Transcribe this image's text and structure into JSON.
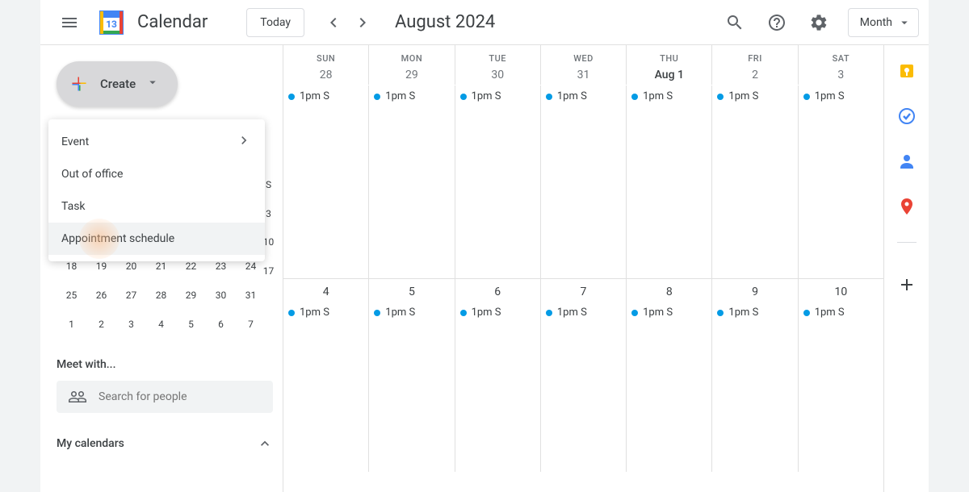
{
  "header": {
    "app_title": "Calendar",
    "today_label": "Today",
    "month_title": "August 2024",
    "view_label": "Month",
    "logo_date": "13"
  },
  "sidebar": {
    "create_label": "Create",
    "dropdown": {
      "items": [
        {
          "label": "Event",
          "has_submenu": true
        },
        {
          "label": "Out of office",
          "has_submenu": false
        },
        {
          "label": "Task",
          "has_submenu": false
        },
        {
          "label": "Appointment schedule",
          "has_submenu": false
        }
      ]
    },
    "mini_cal": {
      "visible_rows": [
        [
          "S",
          "",
          "",
          "",
          "",
          "",
          ""
        ],
        [
          "3",
          "",
          "",
          "",
          "",
          "",
          ""
        ],
        [
          "10",
          "",
          "",
          "",
          "",
          "",
          ""
        ],
        [
          "17",
          "",
          "",
          "",
          "",
          "",
          ""
        ],
        [
          "18",
          "19",
          "20",
          "21",
          "22",
          "23",
          "24"
        ],
        [
          "25",
          "26",
          "27",
          "28",
          "29",
          "30",
          "31"
        ],
        [
          "1",
          "2",
          "3",
          "4",
          "5",
          "6",
          "7"
        ]
      ]
    },
    "meet_title": "Meet with...",
    "search_placeholder": "Search for people",
    "my_calendars_label": "My calendars"
  },
  "calendar": {
    "days_of_week": [
      "SUN",
      "MON",
      "TUE",
      "WED",
      "THU",
      "FRI",
      "SAT"
    ],
    "week1": {
      "dates": [
        "28",
        "29",
        "30",
        "31",
        "Aug 1",
        "2",
        "3"
      ],
      "current_index": 4,
      "events": [
        "1pm S",
        "1pm S",
        "1pm S",
        "1pm S",
        "1pm S",
        "1pm S",
        "1pm S"
      ]
    },
    "week2": {
      "dates": [
        "4",
        "5",
        "6",
        "7",
        "8",
        "9",
        "10"
      ],
      "events": [
        "1pm S",
        "1pm S",
        "1pm S",
        "1pm S",
        "1pm S",
        "1pm S",
        "1pm S"
      ]
    }
  },
  "right_rail": {
    "icons": [
      "keep-icon",
      "tasks-icon",
      "contacts-icon",
      "maps-icon"
    ]
  }
}
